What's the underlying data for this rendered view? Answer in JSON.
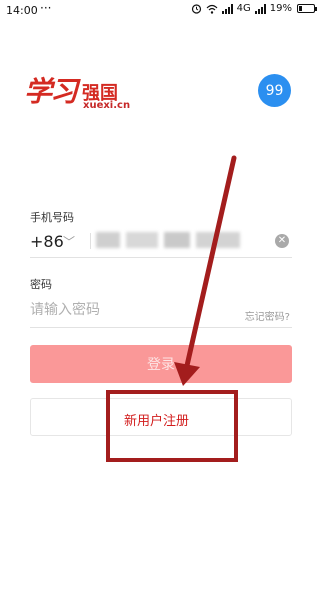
{
  "status_bar": {
    "time": "14:00",
    "dots": "···",
    "network": "4G",
    "battery_text": "19%",
    "battery_level": 0.19,
    "icons": [
      "alarm-icon",
      "wifi-icon",
      "signal-icon",
      "signal-icon",
      "battery-icon"
    ]
  },
  "logo": {
    "main_text": "学习",
    "sub_text": "强国",
    "url_text": "xuexi.cn"
  },
  "avatar": {
    "text": "99",
    "color": "#2b8ff0"
  },
  "phone": {
    "label": "手机号码",
    "country_code": "+86",
    "chevron": "﹀",
    "clear_icon": "✕"
  },
  "password": {
    "label": "密码",
    "placeholder": "请输入密码",
    "forgot_label": "忘记密码?"
  },
  "login": {
    "label": "登录",
    "color": "#fa9898"
  },
  "register": {
    "label": "新用户注册",
    "text_color": "#d21d1d"
  },
  "annotation": {
    "color": "#a31d1d"
  }
}
